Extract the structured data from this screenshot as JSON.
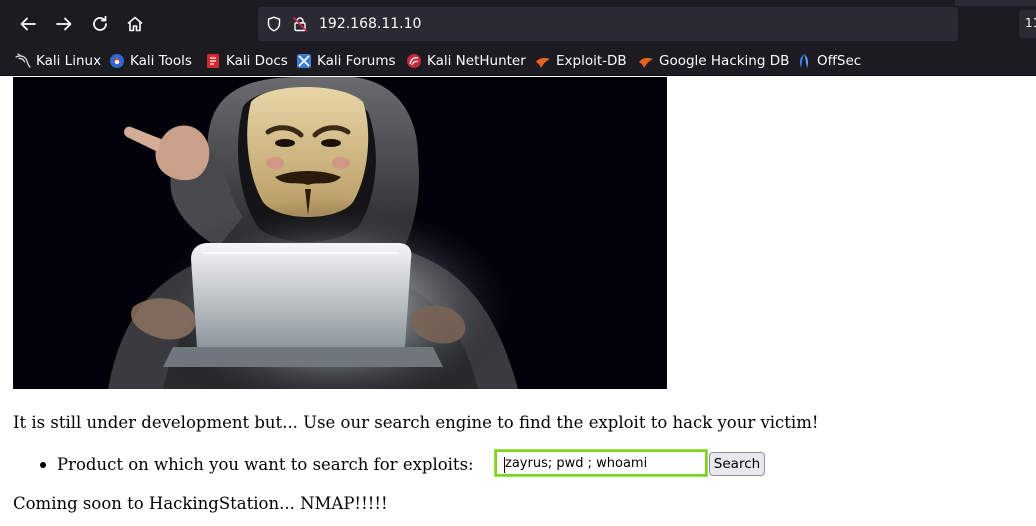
{
  "browser": {
    "url": "192.168.11.10",
    "side_field_text": "11",
    "bookmarks": [
      {
        "label": "Kali Linux",
        "icon": "kali-dragon-icon"
      },
      {
        "label": "Kali Tools",
        "icon": "kali-tools-icon"
      },
      {
        "label": "Kali Docs",
        "icon": "kali-docs-icon"
      },
      {
        "label": "Kali Forums",
        "icon": "kali-forums-icon"
      },
      {
        "label": "Kali NetHunter",
        "icon": "kali-nethunter-icon"
      },
      {
        "label": "Exploit-DB",
        "icon": "exploit-db-icon"
      },
      {
        "label": "Google Hacking DB",
        "icon": "ghdb-icon"
      },
      {
        "label": "OffSec",
        "icon": "offsec-icon"
      }
    ]
  },
  "page": {
    "intro_text": "It is still under development but... Use our search engine to find the exploit to hack your victim!",
    "search_label": "Product on which you want to search for exploits:",
    "search_value": "zayrus; pwd ; whoami",
    "search_button": "Search",
    "coming_soon": "Coming soon to HackingStation... NMAP!!!!!"
  },
  "colors": {
    "chrome_bg": "#1c1b22",
    "urlbar_bg": "#2b2a33",
    "input_focus": "#7ed321"
  }
}
